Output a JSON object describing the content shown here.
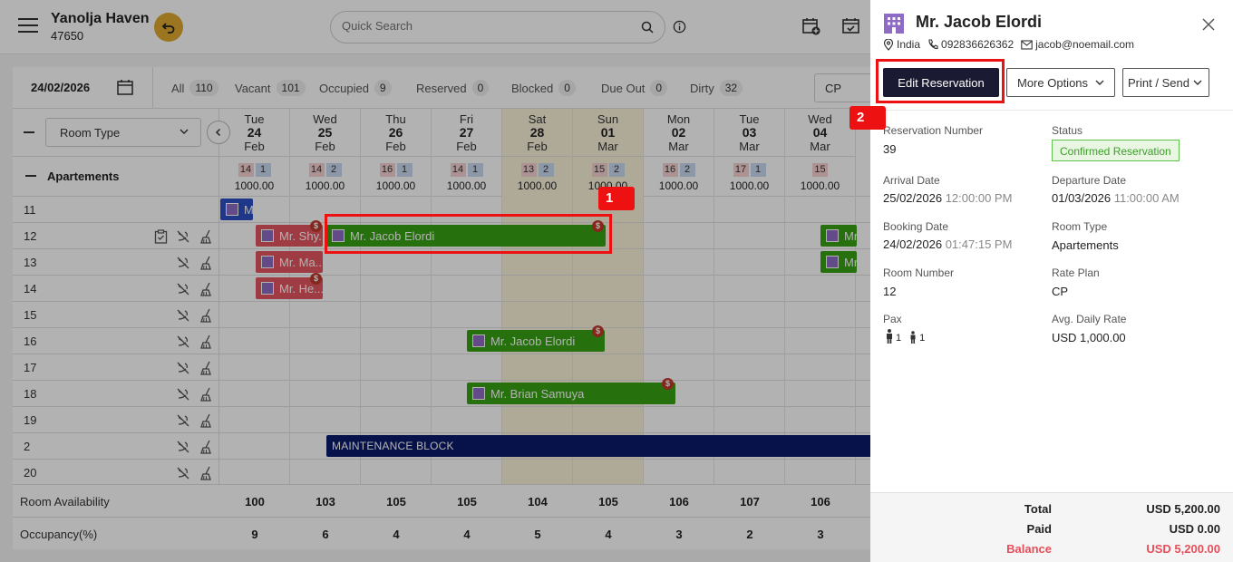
{
  "header": {
    "property_name": "Yanolja Haven",
    "property_code": "47650",
    "search_placeholder": "Quick Search"
  },
  "toolbar": {
    "date": "24/02/2026",
    "filters": [
      {
        "label": "All",
        "count": "110"
      },
      {
        "label": "Vacant",
        "count": "101"
      },
      {
        "label": "Occupied",
        "count": "9"
      },
      {
        "label": "Reserved",
        "count": "0"
      },
      {
        "label": "Blocked",
        "count": "0"
      },
      {
        "label": "Due Out",
        "count": "0"
      },
      {
        "label": "Dirty",
        "count": "32"
      }
    ],
    "rate_plan": "CP"
  },
  "grid": {
    "room_type_select": "Room Type",
    "group_name": "Apartements",
    "days": [
      {
        "dow": "Tue",
        "day": "24",
        "month": "Feb",
        "avail": "14",
        "occ": "1",
        "rate": "1000.00"
      },
      {
        "dow": "Wed",
        "day": "25",
        "month": "Feb",
        "avail": "14",
        "occ": "2",
        "rate": "1000.00"
      },
      {
        "dow": "Thu",
        "day": "26",
        "month": "Feb",
        "avail": "16",
        "occ": "1",
        "rate": "1000.00"
      },
      {
        "dow": "Fri",
        "day": "27",
        "month": "Feb",
        "avail": "14",
        "occ": "1",
        "rate": "1000.00"
      },
      {
        "dow": "Sat",
        "day": "28",
        "month": "Feb",
        "avail": "13",
        "occ": "2",
        "rate": "1000.00"
      },
      {
        "dow": "Sun",
        "day": "01",
        "month": "Mar",
        "avail": "15",
        "occ": "2",
        "rate": "1000.00"
      },
      {
        "dow": "Mon",
        "day": "02",
        "month": "Mar",
        "avail": "16",
        "occ": "2",
        "rate": "1000.00"
      },
      {
        "dow": "Tue",
        "day": "03",
        "month": "Mar",
        "avail": "17",
        "occ": "1",
        "rate": "1000.00"
      },
      {
        "dow": "Wed",
        "day": "04",
        "month": "Mar",
        "avail": "15",
        "occ": "",
        "rate": "1000.00"
      }
    ],
    "rooms": [
      "11",
      "12",
      "13",
      "14",
      "15",
      "16",
      "17",
      "18",
      "19",
      "2",
      "20"
    ],
    "reservations": [
      {
        "label": "M",
        "row": 0
      },
      {
        "label": "Mr. Shy...",
        "row": 1
      },
      {
        "label": "Mr. Jacob Elordi",
        "row": 1
      },
      {
        "label": "Mr. Ja",
        "row": 1
      },
      {
        "label": "Mr. Ma...",
        "row": 2
      },
      {
        "label": "Mr. Jo",
        "row": 2
      },
      {
        "label": "Mr. He...",
        "row": 3
      },
      {
        "label": "Mr. Jacob Elordi",
        "row": 5
      },
      {
        "label": "Mr. Brian Samuya",
        "row": 7
      }
    ],
    "block_label": "MAINTENANCE BLOCK",
    "payment_badge": "$",
    "footer": {
      "availability_label": "Room Availability",
      "availability": [
        "100",
        "103",
        "105",
        "105",
        "104",
        "105",
        "106",
        "107",
        "106"
      ],
      "occupancy_label": "Occupancy(%)",
      "occupancy": [
        "9",
        "6",
        "4",
        "4",
        "5",
        "4",
        "3",
        "2",
        "3"
      ]
    }
  },
  "panel": {
    "guest_name": "Mr. Jacob Elordi",
    "country": "India",
    "phone": "092836626362",
    "email": "jacob@noemail.com",
    "buttons": {
      "edit": "Edit Reservation",
      "more": "More Options",
      "print": "Print / Send"
    },
    "fields": {
      "reservation_number_label": "Reservation Number",
      "reservation_number": "39",
      "status_label": "Status",
      "status": "Confirmed Reservation",
      "arrival_label": "Arrival Date",
      "arrival_date": "25/02/2026",
      "arrival_time": "12:00:00 PM",
      "departure_label": "Departure Date",
      "departure_date": "01/03/2026",
      "departure_time": "11:00:00 AM",
      "booking_label": "Booking Date",
      "booking_date": "24/02/2026",
      "booking_time": "01:47:15 PM",
      "room_type_label": "Room Type",
      "room_type": "Apartements",
      "room_number_label": "Room Number",
      "room_number": "12",
      "rate_plan_label": "Rate Plan",
      "rate_plan": "CP",
      "pax_label": "Pax",
      "pax_adults": "1",
      "pax_children": "1",
      "adr_label": "Avg. Daily Rate",
      "adr": "USD 1,000.00"
    },
    "totals": {
      "total_label": "Total",
      "total": "USD 5,200.00",
      "paid_label": "Paid",
      "paid": "USD 0.00",
      "balance_label": "Balance",
      "balance": "USD 5,200.00"
    }
  },
  "annotations": [
    "1",
    "2"
  ],
  "colors": {
    "accent": "#e0a82e",
    "reservation": "#37a315",
    "unpaid": "#e4555f",
    "block": "#0b1a6b",
    "annotation": "#ee1111"
  }
}
